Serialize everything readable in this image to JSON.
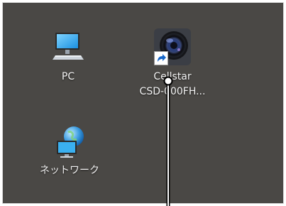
{
  "desktop": {
    "icons": [
      {
        "label": "PC",
        "icon": "computer-icon"
      },
      {
        "label": "Cellstar",
        "label2": "CSD-000FH...",
        "icon": "camera-lens-icon",
        "overlay": "shortcut-arrow-icon"
      },
      {
        "label": "ネットワーク",
        "icon": "network-globe-icon"
      }
    ],
    "colors": {
      "background": "#4a4845",
      "text": "#f2f2f2",
      "annotation_line": "#ffffff"
    }
  },
  "annotation": {
    "type": "pointer-line",
    "color": "#ffffff"
  }
}
